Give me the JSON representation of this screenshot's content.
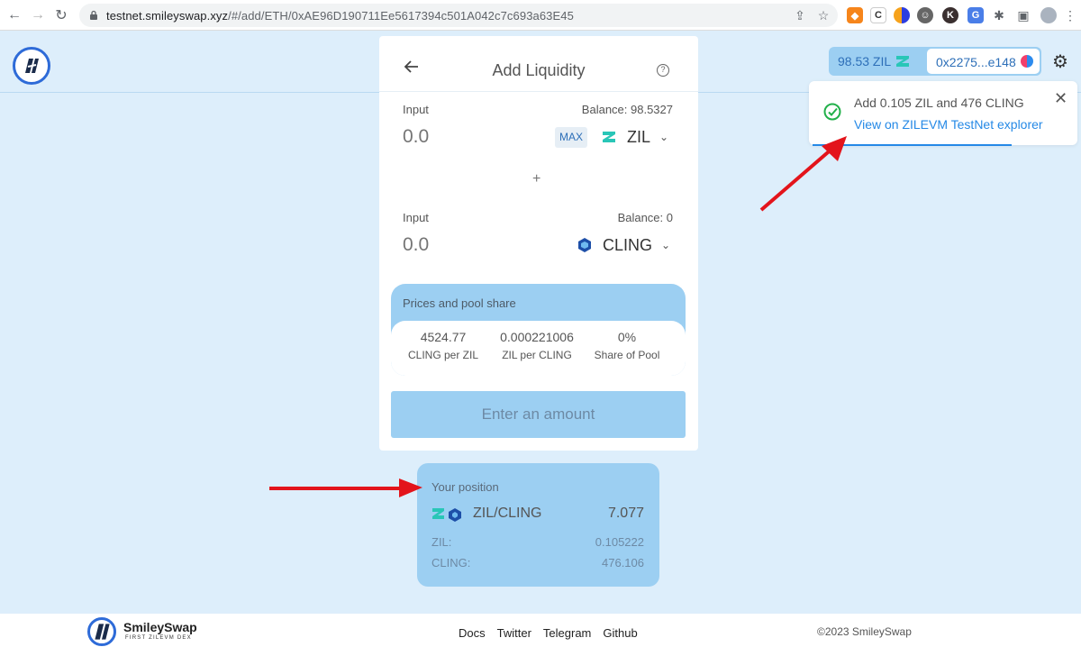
{
  "browser": {
    "url_host": "testnet.smileyswap.xyz",
    "url_path": "/#/add/ETH/0xAE96D190711Ee5617394c501A042c7c693a63E45"
  },
  "header": {
    "zil_balance": "98.53 ZIL",
    "address": "0x2275...e148"
  },
  "toast": {
    "message": "Add 0.105 ZIL and 476 CLING",
    "link": "View on ZILEVM TestNet explorer",
    "close": "✕"
  },
  "card": {
    "title": "Add Liquidity",
    "input1": {
      "label": "Input",
      "balance": "Balance: 98.5327",
      "placeholder": "0.0",
      "max": "MAX",
      "token": "ZIL"
    },
    "plus": "+",
    "input2": {
      "label": "Input",
      "balance": "Balance: 0",
      "placeholder": "0.0",
      "token": "CLING"
    },
    "pool": {
      "title": "Prices and pool share",
      "stats": [
        {
          "value": "4524.77",
          "label": "CLING per ZIL"
        },
        {
          "value": "0.000221006",
          "label": "ZIL per CLING"
        },
        {
          "value": "0%",
          "label": "Share of Pool"
        }
      ]
    },
    "button": "Enter an amount"
  },
  "position": {
    "title": "Your position",
    "pair": "ZIL/CLING",
    "total": "7.077",
    "rows": [
      {
        "label": "ZIL:",
        "value": "0.105222"
      },
      {
        "label": "CLING:",
        "value": "476.106"
      }
    ]
  },
  "footer": {
    "brand": "SmileySwap",
    "tagline": "FIRST ZILEVM DEX",
    "links": [
      "Docs",
      "Twitter",
      "Telegram",
      "Github"
    ],
    "copyright": "©2023 SmileySwap"
  },
  "colors": {
    "page_bg": "#ddeefb",
    "accent_blue": "#9ccff2",
    "link_blue": "#2589e6",
    "arrow_red": "#e3141b",
    "success_green": "#22b04a"
  }
}
